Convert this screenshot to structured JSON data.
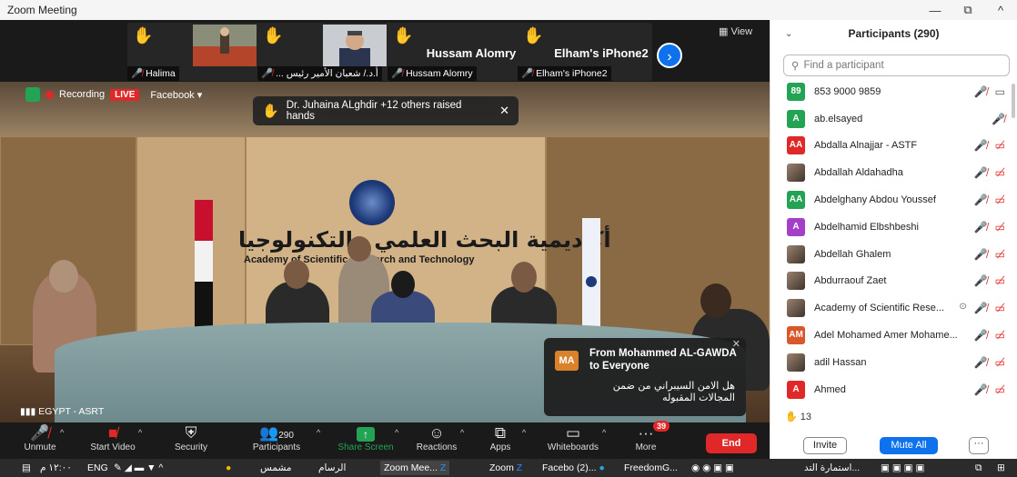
{
  "window": {
    "title": "Zoom Meeting",
    "minimize": "—",
    "restore": "⧉",
    "close": "^"
  },
  "strip": {
    "tiles": [
      {
        "label": "Halima"
      },
      {
        "label": "... أ.د./ شعبان الأمير رئيس"
      },
      {
        "big": "Hussam Alomry",
        "label": "Hussam Alomry"
      },
      {
        "big": "Elham's iPhone2",
        "label": "Elham's iPhone2"
      }
    ],
    "view": "View"
  },
  "recording": {
    "label": "Recording",
    "live": "LIVE",
    "platform": "Facebook"
  },
  "raise_toast": {
    "text": "Dr. Juhaina ALghdir +12 others raised hands"
  },
  "scene": {
    "sign_ar": "أكاديمية البحث العلمي والتكنولوجيا",
    "sign_en": "Academy of Scientific Research and Technology"
  },
  "chat_toast": {
    "initials": "MA",
    "from": "From Mohammed AL-GAWDA to Everyone",
    "message": "هل الامن السيبراني من ضمن المجالات المقبوله"
  },
  "video_label": "EGYPT - ASRT",
  "toolbar": {
    "unmute": "Unmute",
    "start_video": "Start Video",
    "security": "Security",
    "participants": "Participants",
    "participants_count": "290",
    "share": "Share Screen",
    "reactions": "Reactions",
    "apps": "Apps",
    "whiteboards": "Whiteboards",
    "more": "More",
    "more_badge": "39",
    "end": "End"
  },
  "panel": {
    "title": "Participants (290)",
    "search_placeholder": "Find a participant",
    "participants": [
      {
        "initials": "89",
        "color": "#23a455",
        "name": "853 9000 9859",
        "video": "on"
      },
      {
        "initials": "A",
        "color": "#23a455",
        "name": "ab.elsayed",
        "video": "none"
      },
      {
        "initials": "AA",
        "color": "#e02828",
        "name": "Abdalla Alnajjar - ASTF",
        "video": "off"
      },
      {
        "initials": "",
        "color": "photo",
        "name": "Abdallah Aldahadha",
        "video": "off"
      },
      {
        "initials": "AA",
        "color": "#23a455",
        "name": "Abdelghany Abdou Youssef",
        "video": "off"
      },
      {
        "initials": "A",
        "color": "#a440c8",
        "name": "Abdelhamid Elbshbeshi",
        "video": "off"
      },
      {
        "initials": "",
        "color": "photo",
        "name": "Abdellah Ghalem",
        "video": "off"
      },
      {
        "initials": "",
        "color": "photo",
        "name": "Abdurraouf Zaet",
        "video": "off"
      },
      {
        "initials": "",
        "color": "photo",
        "name": "Academy of Scientific Rese...",
        "video": "off",
        "recording": true
      },
      {
        "initials": "AM",
        "color": "#d9582b",
        "name": "Adel Mohamed Amer Mohame...",
        "video": "off"
      },
      {
        "initials": "",
        "color": "photo",
        "name": "adil Hassan",
        "video": "off"
      },
      {
        "initials": "A",
        "color": "#e02828",
        "name": "Ahmed",
        "video": "off"
      }
    ],
    "raised_count": "13",
    "invite": "Invite",
    "mute_all": "Mute All",
    "more": "···"
  },
  "taskbar": {
    "time": "١٢:٠٠ م",
    "lang": "ENG",
    "items": [
      "مشمس",
      "الرسام",
      "Zoom Mee...",
      "Zoom",
      "Facebo (2)...",
      "FreedomG...",
      "استمارة التد..."
    ]
  }
}
